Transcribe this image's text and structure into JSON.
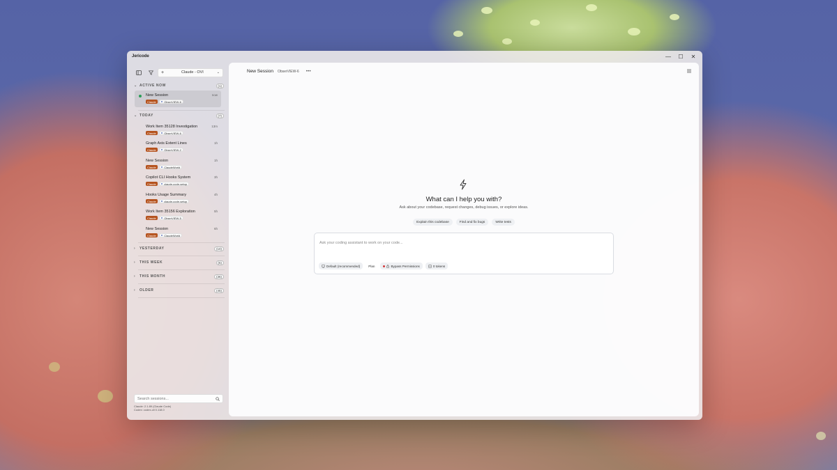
{
  "app": {
    "title": "Jericode"
  },
  "window_controls": {
    "minimize": "—",
    "maximize": "☐",
    "close": "✕"
  },
  "sidebar": {
    "model_select": {
      "plus": "+",
      "label": "Claude - OVI",
      "chevron": "⌄"
    },
    "sections": {
      "active": {
        "label": "ACTIVE NOW",
        "count": "(1)"
      },
      "today": {
        "label": "TODAY",
        "count": "(7)"
      },
      "yesterday": {
        "label": "YESTERDAY",
        "count": "(10)"
      },
      "this_week": {
        "label": "THIS WEEK",
        "count": "(5)"
      },
      "this_month": {
        "label": "THIS MONTH",
        "count": "(36)"
      },
      "older": {
        "label": "OLDER",
        "count": "(45)"
      }
    },
    "active_sessions": [
      {
        "title": "New Session",
        "time": "now",
        "agent": "Claude",
        "project": "ObserVIEW-6"
      }
    ],
    "today_sessions": [
      {
        "title": "Work Item 35128 Investigation",
        "time": "13m",
        "agent": "Claude",
        "project": "ObserVIEW-6"
      },
      {
        "title": "Graph Axis Extent Lines",
        "time": "1h",
        "agent": "Claude",
        "project": "ObserVIEW-2"
      },
      {
        "title": "New Session",
        "time": "1h",
        "agent": "Claude",
        "project": "ClaudeWorld"
      },
      {
        "title": "Copilot CLI Hooks System",
        "time": "3h",
        "agent": "Claude",
        "project": "claude-code-setup"
      },
      {
        "title": "Hooks Usage Summary",
        "time": "4h",
        "agent": "Claude",
        "project": "claude-code-setup"
      },
      {
        "title": "Work Item 35156 Exploration",
        "time": "5h",
        "agent": "Claude",
        "project": "ObserVIEW-5"
      },
      {
        "title": "New Session",
        "time": "6h",
        "agent": "Claude",
        "project": "ClaudeWorld"
      }
    ],
    "search": {
      "placeholder": "Search sessions..."
    },
    "version_lines": [
      "Claude: 2.1.89 (Claude Code)",
      "Codex: codex-cli 0.118.0"
    ]
  },
  "main": {
    "title": "New Session",
    "project": "ObserVIEW-6",
    "more": "•••",
    "hero_title": "What can I help you with?",
    "hero_subtitle": "Ask about your codebase, request changes, debug issues, or explore ideas.",
    "suggestions": [
      "Explain this codebase",
      "Find and fix bugs",
      "Write tests"
    ],
    "composer": {
      "placeholder": "Ask your coding assistant to work on your code...",
      "model": "Default (recommended)",
      "mode": "Plan",
      "permissions": "Bypass Permissions",
      "tokens": "0 tokens"
    }
  },
  "colors": {
    "agent_tag": "#b5531e",
    "active_dot": "#2a9d57",
    "bypass_dot": "#d23b3b"
  }
}
